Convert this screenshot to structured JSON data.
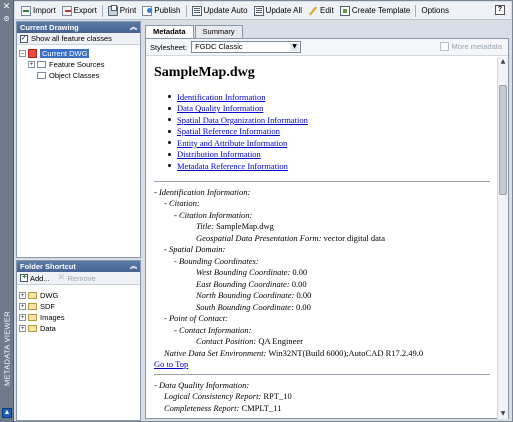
{
  "palette": {
    "title": "METADATA VIEWER",
    "close_glyph": "✕",
    "pin_glyph": "⚙"
  },
  "toolbar": {
    "import_label": "Import",
    "export_label": "Export",
    "print_label": "Print",
    "publish_label": "Publish",
    "update_auto_label": "Update Auto",
    "update_all_label": "Update All",
    "edit_label": "Edit",
    "create_template_label": "Create Template",
    "options_label": "Options",
    "help_label": "?"
  },
  "current_drawing": {
    "header": "Current Drawing",
    "show_all_label": "Show all feature classes",
    "show_all_checked": true,
    "tree": {
      "root": "Current DWG",
      "children": [
        "Feature Sources",
        "Object Classes"
      ]
    }
  },
  "folder_shortcut": {
    "header": "Folder Shortcut",
    "add_label": "Add...",
    "remove_label": "Remove",
    "folders": [
      "DWG",
      "SDF",
      "Images",
      "Data"
    ]
  },
  "tabs": [
    {
      "label": "Metadata",
      "active": true
    },
    {
      "label": "Summary",
      "active": false
    }
  ],
  "stylesheet": {
    "label": "Stylesheet:",
    "value": "FGDC Classic",
    "more_label": "More metadata"
  },
  "document": {
    "title": "SampleMap.dwg",
    "toc": [
      "Identification Information",
      "Data Quality Information",
      "Spatial Data Organization Information",
      "Spatial Reference Information",
      "Entity and Attribute Information",
      "Distribution Information",
      "Metadata Reference Information"
    ],
    "identification": {
      "section": "- Identification Information:",
      "citation": "- Citation:",
      "citation_info": "- Citation Information:",
      "title_label": "Title:",
      "title_value": "SampleMap.dwg",
      "geo_label": "Geospatial Data Presentation Form:",
      "geo_value": "vector digital data",
      "spatial_domain": "- Spatial Domain:",
      "bounding": "- Bounding Coordinates:",
      "west_label": "West Bounding Coordinate:",
      "west_value": "0.00",
      "east_label": "East Bounding Coordinate:",
      "east_value": "0.00",
      "north_label": "North Bounding Coordinate:",
      "north_value": "0.00",
      "south_label": "South Bounding Coordinate:",
      "south_value": "0.00",
      "poc": "- Point of Contact:",
      "contact_info": "- Contact Information:",
      "position_label": "Contact Position:",
      "position_value": "QA Engineer",
      "env_label": "Native Data Set Environment:",
      "env_value": "Win32NT(Build 6000);AutoCAD R17.2.49.0",
      "go_top": "Go to Top"
    },
    "data_quality": {
      "section": "- Data Quality Information:",
      "logical_label": "Logical Consistency Report:",
      "logical_value": "RPT_10",
      "complete_label": "Completeness Report:",
      "complete_value": "CMPLT_11"
    }
  }
}
